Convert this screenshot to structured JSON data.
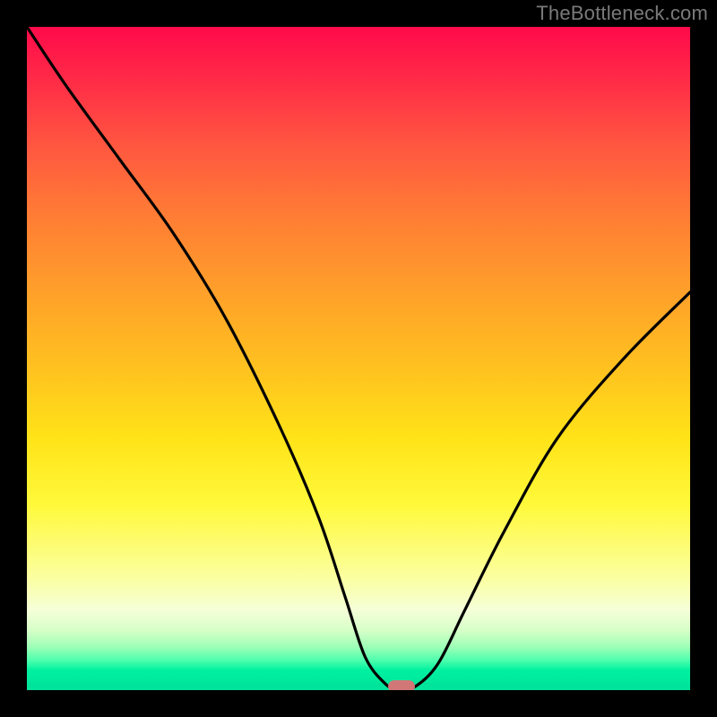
{
  "watermark": "TheBottleneck.com",
  "chart_data": {
    "type": "line",
    "title": "",
    "xlabel": "",
    "ylabel": "",
    "x_range": [
      0,
      100
    ],
    "y_range": [
      0,
      100
    ],
    "series": [
      {
        "name": "curve",
        "x": [
          0,
          6,
          14,
          22,
          30,
          38,
          44,
          48,
          51,
          54,
          56,
          58.5,
          62,
          66,
          72,
          80,
          90,
          100
        ],
        "values": [
          100,
          91,
          80,
          69,
          56,
          40,
          26,
          14,
          5,
          1,
          0,
          0.5,
          4,
          12,
          24,
          38,
          50,
          60
        ]
      }
    ],
    "marker": {
      "x": 56.5,
      "y": 0
    },
    "gradient_stops": [
      {
        "pos": 0,
        "color": "#ff0a4a"
      },
      {
        "pos": 0.5,
        "color": "#ffc31f"
      },
      {
        "pos": 0.82,
        "color": "#fff93a"
      },
      {
        "pos": 0.95,
        "color": "#4dffad"
      },
      {
        "pos": 1.0,
        "color": "#00e39a"
      }
    ]
  }
}
